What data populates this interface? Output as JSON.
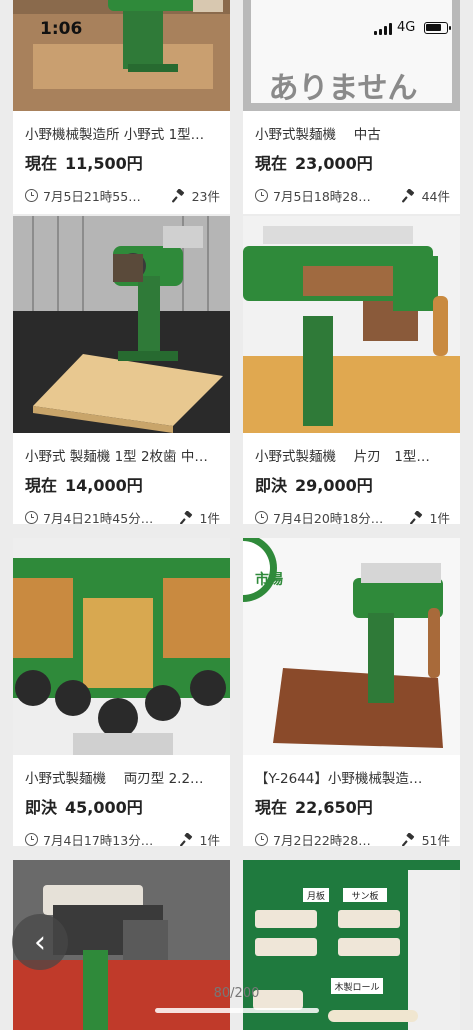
{
  "status_bar": {
    "time": "1:06",
    "network": "4G"
  },
  "listings": [
    {
      "title": "小野機械製造所 小野式 1型…",
      "price_label": "現在",
      "price": "11,500円",
      "end_time": "7月5日21時55…",
      "bids": "23件",
      "image": "noodle-machine-on-wood"
    },
    {
      "title": "小野式製麺機　 中古",
      "price_label": "現在",
      "price": "23,000円",
      "end_time": "7月5日18時28…",
      "bids": "44件",
      "image": "no-image-placeholder",
      "image_text": "ありません"
    },
    {
      "title": "小野式 製麺機 1型 2枚歯 中…",
      "price_label": "現在",
      "price": "14,000円",
      "end_time": "7月4日21時45分…",
      "bids": "1件",
      "image": "green-noodle-machine"
    },
    {
      "title": "小野式製麺機　 片刃　1型…",
      "price_label": "即決",
      "price": "29,000円",
      "end_time": "7月4日20時18分…",
      "bids": "1件",
      "image": "green-noodle-machine-closeup"
    },
    {
      "title": "小野式製麺機　 両刃型 2.2…",
      "price_label": "即決",
      "price": "45,000円",
      "end_time": "7月4日17時13分…",
      "bids": "1件",
      "image": "gear-rollers"
    },
    {
      "title": "【Y-2644】小野機械製造…",
      "price_label": "現在",
      "price": "22,650円",
      "end_time": "7月2日22時28…",
      "bids": "51件",
      "image": "noodle-machine-white-bg",
      "image_badge": "市場"
    },
    {
      "title": "",
      "price_label": "",
      "price": "",
      "end_time": "",
      "bids": "",
      "image": "noodle-machine-red-bg"
    },
    {
      "title": "",
      "price_label": "",
      "price": "",
      "end_time": "",
      "bids": "",
      "image": "parts-layout",
      "image_labels": [
        "月板",
        "サン板",
        "木製ロール"
      ]
    }
  ],
  "pager": {
    "counter": "80/200"
  },
  "colors": {
    "machine_green": "#2f8a3a",
    "wood": "#d9a55a"
  }
}
